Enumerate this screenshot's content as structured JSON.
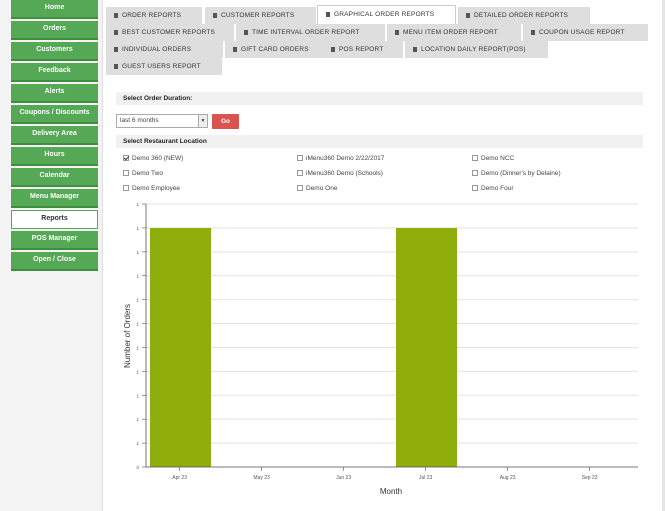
{
  "sidebar": {
    "items": [
      {
        "label": "Home",
        "name": "sidebar-item-home"
      },
      {
        "label": "Orders",
        "name": "sidebar-item-orders"
      },
      {
        "label": "Customers",
        "name": "sidebar-item-customers"
      },
      {
        "label": "Feedback",
        "name": "sidebar-item-feedback"
      },
      {
        "label": "Alerts",
        "name": "sidebar-item-alerts"
      },
      {
        "label": "Coupons / Discounts",
        "name": "sidebar-item-coupons"
      },
      {
        "label": "Delivery Area",
        "name": "sidebar-item-delivery-area"
      },
      {
        "label": "Hours",
        "name": "sidebar-item-hours"
      },
      {
        "label": "Calendar",
        "name": "sidebar-item-calendar"
      },
      {
        "label": "Menu Manager",
        "name": "sidebar-item-menu-manager"
      },
      {
        "label": "Reports",
        "name": "sidebar-item-reports",
        "active": true
      },
      {
        "label": "POS Manager",
        "name": "sidebar-item-pos-manager"
      },
      {
        "label": "Open / Close",
        "name": "sidebar-item-open-close"
      }
    ]
  },
  "tabs": [
    {
      "label": "ORDER REPORTS",
      "name": "tab-order-reports"
    },
    {
      "label": "CUSTOMER REPORTS",
      "name": "tab-customer-reports"
    },
    {
      "label": "GRAPHICAL ORDER REPORTS",
      "name": "tab-graphical-order-reports",
      "active": true
    },
    {
      "label": "DETAILED ORDER REPORTS",
      "name": "tab-detailed-order-reports"
    },
    {
      "label": "BEST CUSTOMER REPORTS",
      "name": "tab-best-customer-reports"
    },
    {
      "label": "TIME INTERVAL ORDER REPORT",
      "name": "tab-time-interval-order-report"
    },
    {
      "label": "MENU ITEM ORDER REPORT",
      "name": "tab-menu-item-order-report"
    },
    {
      "label": "COUPON USAGE REPORT",
      "name": "tab-coupon-usage-report"
    },
    {
      "label": "INDIVIDUAL ORDERS",
      "name": "tab-individual-orders"
    },
    {
      "label": "GIFT CARD ORDERS",
      "name": "tab-gift-card-orders"
    },
    {
      "label": "POS REPORT",
      "name": "tab-pos-report"
    },
    {
      "label": "LOCATION DAILY REPORT(POS)",
      "name": "tab-location-daily-report-pos"
    },
    {
      "label": "GUEST USERS REPORT",
      "name": "tab-guest-users-report"
    }
  ],
  "duration": {
    "heading": "Select Order Duration:",
    "selected": "last 6 months",
    "go_label": "Go"
  },
  "locations": {
    "heading": "Select Restaurant Location",
    "items": [
      {
        "label": "Demo 360 (NEW)",
        "checked": true
      },
      {
        "label": "iMenu360 Demo 2/22/2017",
        "checked": false
      },
      {
        "label": "Demo NCC",
        "checked": false
      },
      {
        "label": "Demo Two",
        "checked": false
      },
      {
        "label": "iMenu360 Demo (Schools)",
        "checked": false
      },
      {
        "label": "Demo (Dinner's by Delaine)",
        "checked": false
      },
      {
        "label": "Demo Employee",
        "checked": false
      },
      {
        "label": "Demo One",
        "checked": false
      },
      {
        "label": "Demo Four",
        "checked": false
      }
    ]
  },
  "chart_data": {
    "type": "bar",
    "categories": [
      "Apr 23",
      "May 23",
      "Jun 23",
      "Jul 23",
      "Aug 23",
      "Sep 23"
    ],
    "values": [
      1,
      0,
      0,
      1,
      0,
      0
    ],
    "xlabel": "Month",
    "ylabel": "Number of Orders",
    "ylim": [
      0,
      1
    ],
    "yticks": [
      "0",
      "1",
      "1",
      "1",
      "1",
      "1",
      "1",
      "1",
      "1",
      "1",
      "1",
      "1"
    ],
    "grid": true,
    "bar_color": "#8fae0c"
  },
  "colors": {
    "sidebar_green": "#55a855",
    "go_red": "#d9534f",
    "bar": "#8fae0c"
  }
}
